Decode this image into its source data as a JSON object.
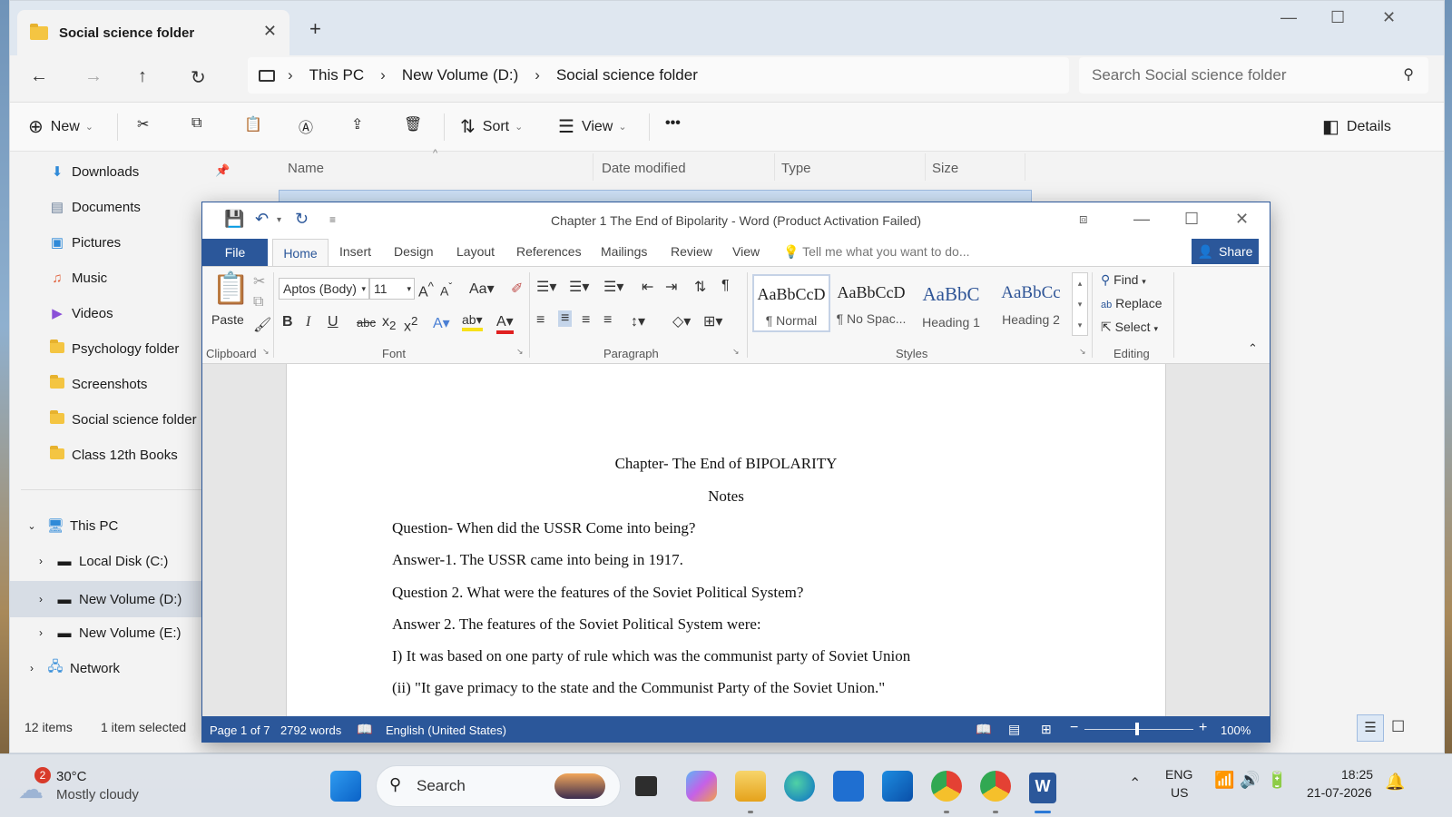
{
  "explorer": {
    "tab_title": "Social science folder",
    "breadcrumb": [
      "This PC",
      "New Volume (D:)",
      "Social science folder"
    ],
    "search_placeholder": "Search Social science folder",
    "toolbar": {
      "new": "New",
      "sort": "Sort",
      "view": "View",
      "more": "•••",
      "details": "Details"
    },
    "sidebar": {
      "quick": [
        "Downloads",
        "Documents",
        "Pictures",
        "Music",
        "Videos",
        "Psychology folder",
        "Screenshots",
        "Social science folder",
        "Class 12th Books"
      ],
      "this_pc": "This PC",
      "drives": [
        "Local Disk (C:)",
        "New Volume (D:)",
        "New Volume (E:)"
      ],
      "network": "Network"
    },
    "columns": [
      "Name",
      "Date modified",
      "Type",
      "Size"
    ],
    "status": {
      "items": "12 items",
      "selected": "1 item selected"
    }
  },
  "word": {
    "title": "Chapter 1 The End of Bipolarity - Word (Product Activation Failed)",
    "tabs": [
      "File",
      "Home",
      "Insert",
      "Design",
      "Layout",
      "References",
      "Mailings",
      "Review",
      "View"
    ],
    "tell_me": "Tell me what you want to do...",
    "share": "Share",
    "ribbon": {
      "paste": "Paste",
      "font_name": "Aptos (Body)",
      "font_size": "11",
      "groups": [
        "Clipboard",
        "Font",
        "Paragraph",
        "Styles",
        "Editing"
      ],
      "styles": [
        {
          "preview": "AaBbCcD",
          "name": "¶ Normal"
        },
        {
          "preview": "AaBbCcD",
          "name": "¶ No Spac..."
        },
        {
          "preview": "AaBbC",
          "name": "Heading 1"
        },
        {
          "preview": "AaBbCc",
          "name": "Heading 2"
        }
      ],
      "editing": [
        "Find",
        "Replace",
        "Select"
      ]
    },
    "document": {
      "title": "Chapter- The End of BIPOLARITY",
      "subtitle": "Notes",
      "lines": [
        "Question- When did the USSR Come into being?",
        "Answer-1. The USSR came into being in 1917.",
        "Question 2. What were the features of the Soviet Political System?",
        "Answer 2. The features of the Soviet Political System were:",
        "I) It was based on one party of rule which was the communist party of Soviet Union",
        "(ii) \"It gave primacy to the state and the Communist Party of the Soviet Union.\""
      ]
    },
    "status": {
      "page": "Page 1 of 7",
      "words": "2792 words",
      "language": "English (United States)",
      "zoom": "100%"
    }
  },
  "taskbar": {
    "weather_temp": "30°C",
    "weather_desc": "Mostly cloudy",
    "weather_badge": "2",
    "search": "Search",
    "lang_top": "ENG",
    "lang_bottom": "US",
    "time": "18:25",
    "date": "21-07-2026"
  },
  "colors": {
    "word_blue": "#2b579a",
    "folder_yellow": "#f4c542",
    "selection": "#d7dde5"
  }
}
